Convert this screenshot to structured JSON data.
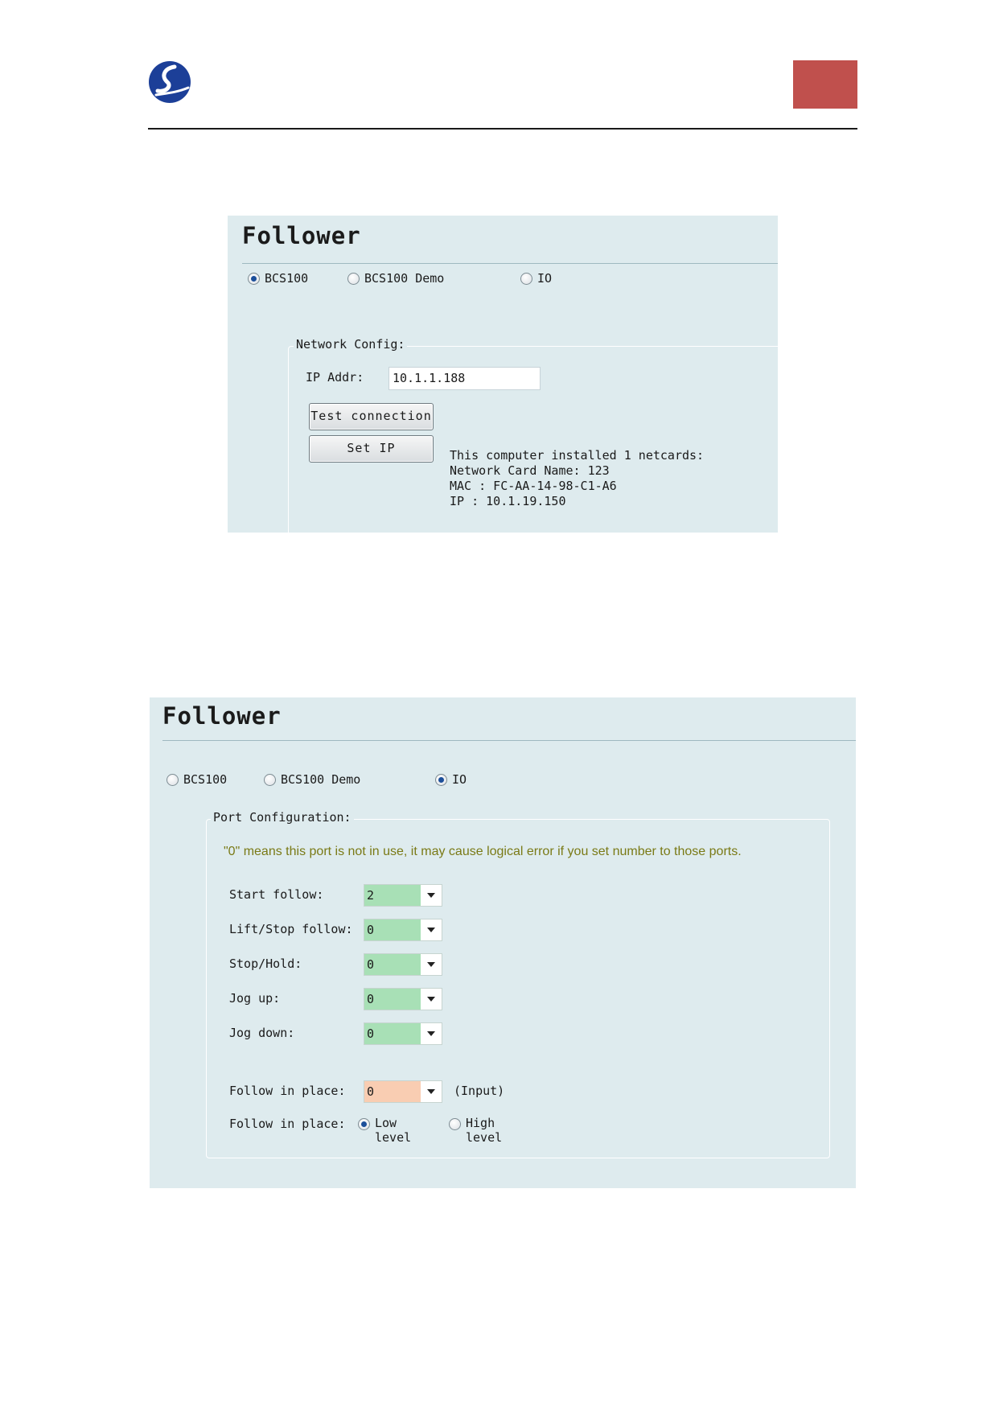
{
  "header": {
    "accent_color": "#c0504d",
    "logo_icon": "company-logo-icon"
  },
  "panel1": {
    "title": "Follower",
    "radios": [
      {
        "label": "BCS100",
        "selected": true
      },
      {
        "label": "BCS100 Demo",
        "selected": false
      },
      {
        "label": "IO",
        "selected": false
      }
    ],
    "network": {
      "legend": "Network Config:",
      "ip_label": "IP Addr:",
      "ip_value": "10.1.1.188",
      "test_button": "Test connection",
      "set_button": "Set IP",
      "info_lines": [
        "This computer installed 1 netcards:",
        "Network Card Name: 123",
        "MAC : FC-AA-14-98-C1-A6",
        "IP : 10.1.19.150"
      ]
    }
  },
  "panel2": {
    "title": "Follower",
    "radios": [
      {
        "label": "BCS100",
        "selected": false
      },
      {
        "label": "BCS100 Demo",
        "selected": false
      },
      {
        "label": "IO",
        "selected": true
      }
    ],
    "port": {
      "legend": "Port Configuration:",
      "note": "\"0\" means this port is not in use, it may cause logical error if you set number to those ports.",
      "fields": [
        {
          "label": "Start follow:",
          "value": "2"
        },
        {
          "label": "Lift/Stop follow:",
          "value": "0"
        },
        {
          "label": "Stop/Hold:",
          "value": "0"
        },
        {
          "label": "Jog up:",
          "value": "0"
        },
        {
          "label": "Jog down:",
          "value": "0"
        }
      ],
      "follow_in_place": {
        "label": "Follow in place:",
        "value": "0",
        "suffix": "(Input)"
      },
      "follow_level": {
        "label": "Follow in place:",
        "options": [
          {
            "line1": "Low",
            "line2": "level",
            "selected": true
          },
          {
            "line1": "High",
            "line2": "level",
            "selected": false
          }
        ]
      }
    }
  }
}
